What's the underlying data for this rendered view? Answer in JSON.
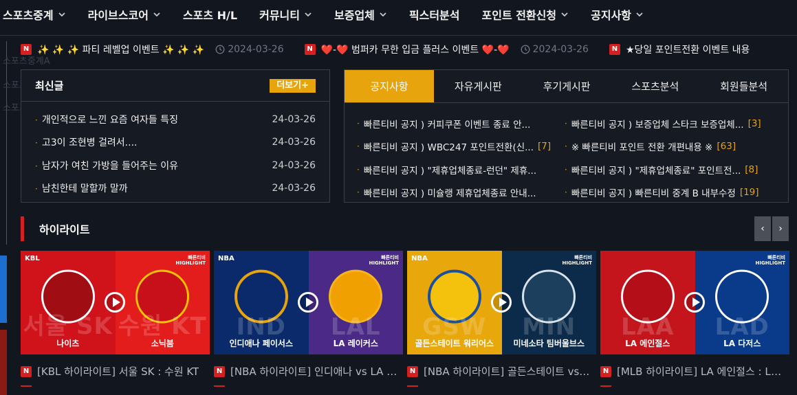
{
  "nav": {
    "items": [
      {
        "label": "스포츠중계",
        "dropdown": true
      },
      {
        "label": "라이브스코어",
        "dropdown": true
      },
      {
        "label": "스포츠 H/L",
        "dropdown": false
      },
      {
        "label": "커뮤니티",
        "dropdown": true
      },
      {
        "label": "보증업체",
        "dropdown": true
      },
      {
        "label": "픽스터분석",
        "dropdown": false
      },
      {
        "label": "포인트 전환신청",
        "dropdown": true
      },
      {
        "label": "공지사항",
        "dropdown": true
      }
    ]
  },
  "ticker": [
    {
      "badge": "N",
      "title": "✨ ✨ ✨ 파티 레벨업 이벤트 ✨ ✨ ✨",
      "date": "2024-03-26"
    },
    {
      "badge": "N",
      "title": "❤️-❤️ 범퍼카 무한 입금 플러스 이벤트 ❤️-❤️",
      "date": "2024-03-26"
    },
    {
      "badge": "N",
      "title": "★당일 포인트전환 이벤트 내용",
      "date": ""
    }
  ],
  "sidebar_ghost": {
    "items": [
      "스포츠중계A",
      "스포츠중계",
      "스포츠중계C"
    ]
  },
  "latest": {
    "title": "최신글",
    "more_label": "더보기+",
    "posts": [
      {
        "title": "개인적으로 느낀 요즘 여자들 특징",
        "date": "24-03-26"
      },
      {
        "title": "고3이 조현병 걸려서....",
        "date": "24-03-26"
      },
      {
        "title": "남자가 여친 가방을 들어주는 이유",
        "date": "24-03-26"
      },
      {
        "title": "남친한테 말할까 말까",
        "date": "24-03-26"
      }
    ]
  },
  "boards": {
    "tabs": [
      "공지사항",
      "자유게시판",
      "후기게시판",
      "스포츠분석",
      "회원들분석"
    ],
    "active_tab": 0,
    "left": [
      {
        "title": "빠른티비 공지 ) 커피쿠폰 이벤트 종료 안...",
        "count": ""
      },
      {
        "title": "빠른티비 공지 ) WBC247 포인트전환(신...",
        "count": "[7]"
      },
      {
        "title": "빠른티비 공지 ) \"제휴업체종료-런던\" 제휴...",
        "count": ""
      },
      {
        "title": "빠른티비 공지 ) 미슐랭 제휴업체종료 안내...",
        "count": ""
      }
    ],
    "right": [
      {
        "title": "빠른티비 공지 ) 보증업체 스타크 보증업체...",
        "count": "[3]"
      },
      {
        "title": "※ 빠른티비 포인트 전환 개편내용 ※",
        "count": "[63]"
      },
      {
        "title": "빠른티비 공지 ) \"제휴업체종료\" 포인트전...",
        "count": "[8]"
      },
      {
        "title": "빠른티비 공지 ) 빠른티비 중계 B 내부수정",
        "count": "[19]"
      }
    ]
  },
  "highlight": {
    "title": "하이라이트",
    "prev": "‹",
    "next": "›",
    "cards": [
      {
        "league": "KBL",
        "tag": "빠른티비",
        "tag2": "HIGHLIGHT",
        "left_team": "나이츠",
        "right_team": "소닉붐",
        "left_ghost": "서울 SK",
        "right_ghost": "수원 KT",
        "left_color": "#d0121b",
        "right_color": "#e31c1c",
        "caption": "[KBL 하이라이트] 서울 SK : 수원 KT"
      },
      {
        "league": "NBA",
        "tag": "빠른티비",
        "tag2": "HIGHLIGHT",
        "left_team": "인디애나 페이서스",
        "right_team": "LA 레이커스",
        "left_ghost": "IND",
        "right_ghost": "LAL",
        "left_color": "#0a2a6b",
        "right_color": "#4a2a86",
        "caption": "[NBA 하이라이트] 인디애나 vs LA 레이커스"
      },
      {
        "league": "NBA",
        "tag": "빠른티비",
        "tag2": "HIGHLIGHT",
        "left_team": "골든스테이트 워리어스",
        "right_team": "미네소타 팀버울브스",
        "left_ghost": "GSW",
        "right_ghost": "MIN",
        "left_color": "#e8a80c",
        "right_color": "#0c2a4a",
        "caption": "[NBA 하이라이트] 골든스테이트 vs 미네소타"
      },
      {
        "league": "",
        "tag": "빠른티비",
        "tag2": "HIGHLIGHT",
        "left_team": "LA 에인절스",
        "right_team": "LA 다저스",
        "left_ghost": "LAA",
        "right_ghost": "LAD",
        "left_color": "#c4141c",
        "right_color": "#0a3a8a",
        "caption": "[MLB 하이라이트] LA 에인절스 : LA 다저스"
      }
    ]
  },
  "colors": {
    "accent": "#e8a40c",
    "red": "#d32020",
    "bg": "#12161f"
  }
}
